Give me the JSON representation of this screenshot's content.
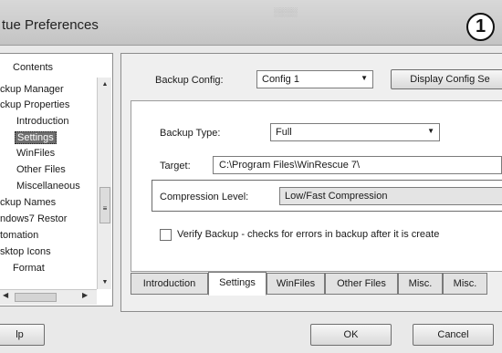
{
  "window": {
    "title": "tue Preferences",
    "badge": "1"
  },
  "tree": {
    "header": "Contents",
    "items": [
      {
        "label": "ckup Manager"
      },
      {
        "label": "ckup Properties"
      },
      {
        "label": "Introduction"
      },
      {
        "label": "Settings",
        "selected": true
      },
      {
        "label": "WinFiles"
      },
      {
        "label": "Other Files"
      },
      {
        "label": "Miscellaneous"
      },
      {
        "label": "ckup Names"
      },
      {
        "label": "ndows7 Restor"
      },
      {
        "label": "tomation"
      },
      {
        "label": "sktop Icons"
      },
      {
        "label": "Format"
      }
    ]
  },
  "backup_config": {
    "label": "Backup Config:",
    "value": "Config 1",
    "display_button": "Display Config Se"
  },
  "settings": {
    "backup_type_label": "Backup Type:",
    "backup_type_value": "Full",
    "target_label": "Target:",
    "target_value": "C:\\Program Files\\WinRescue 7\\",
    "compression_label": "Compression Level:",
    "compression_value": "Low/Fast Compression",
    "verify_label": "Verify Backup - checks for errors in backup after it is create"
  },
  "tabs": [
    {
      "label": "Introduction"
    },
    {
      "label": "Settings",
      "active": true
    },
    {
      "label": "WinFiles"
    },
    {
      "label": "Other Files"
    },
    {
      "label": "Misc."
    },
    {
      "label": "Misc."
    }
  ],
  "buttons": {
    "left": "lp",
    "ok": "OK",
    "cancel": "Cancel"
  },
  "colors": {
    "selection": "#6f6f6f",
    "background": "#e9e9e9",
    "panel": "#ffffff"
  }
}
